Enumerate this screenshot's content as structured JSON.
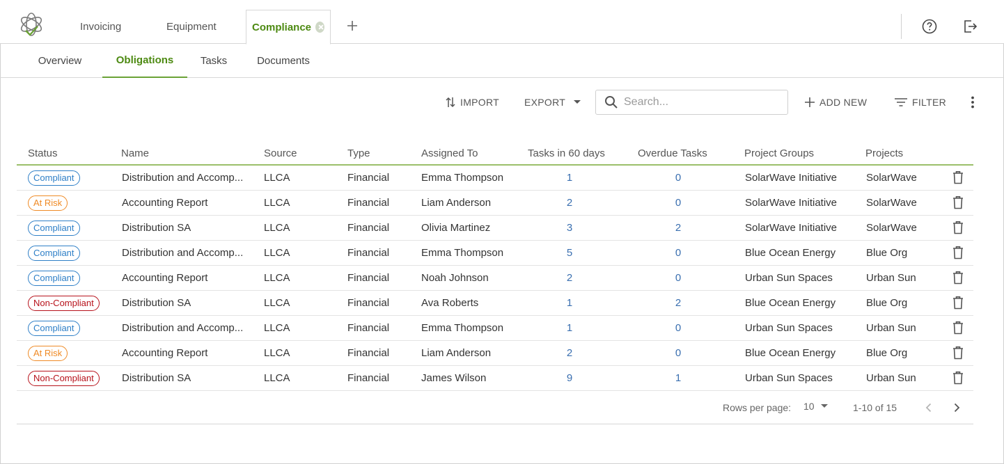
{
  "app_tabs": [
    {
      "label": "Invoicing"
    },
    {
      "label": "Equipment"
    },
    {
      "label": "Compliance"
    }
  ],
  "sub_tabs": [
    {
      "label": "Overview"
    },
    {
      "label": "Obligations"
    },
    {
      "label": "Tasks"
    },
    {
      "label": "Documents"
    }
  ],
  "active_sub_tab": "Obligations",
  "toolbar": {
    "import_label": "IMPORT",
    "export_label": "EXPORT",
    "search_placeholder": "Search...",
    "add_new_label": "ADD NEW",
    "filter_label": "FILTER"
  },
  "table": {
    "columns": [
      "Status",
      "Name",
      "Source",
      "Type",
      "Assigned To",
      "Tasks in 60 days",
      "Overdue Tasks",
      "Project Groups",
      "Projects"
    ],
    "rows": [
      {
        "status": "Compliant",
        "status_kind": "compliant",
        "name": "Distribution and Accomp...",
        "source": "LLCA",
        "type": "Financial",
        "assigned": "Emma Thompson",
        "tasks": "1",
        "overdue": "0",
        "group": "SolarWave Initiative",
        "project": "SolarWave"
      },
      {
        "status": "At Risk",
        "status_kind": "atrisk",
        "name": "Accounting Report",
        "source": "LLCA",
        "type": "Financial",
        "assigned": "Liam Anderson",
        "tasks": "2",
        "overdue": "0",
        "group": "SolarWave Initiative",
        "project": "SolarWave"
      },
      {
        "status": "Compliant",
        "status_kind": "compliant",
        "name": "Distribution SA",
        "source": "LLCA",
        "type": "Financial",
        "assigned": "Olivia Martinez",
        "tasks": "3",
        "overdue": "2",
        "group": "SolarWave Initiative",
        "project": "SolarWave"
      },
      {
        "status": "Compliant",
        "status_kind": "compliant",
        "name": "Distribution and Accomp...",
        "source": "LLCA",
        "type": "Financial",
        "assigned": "Emma Thompson",
        "tasks": "5",
        "overdue": "0",
        "group": "Blue Ocean Energy",
        "project": "Blue Org"
      },
      {
        "status": "Compliant",
        "status_kind": "compliant",
        "name": "Accounting Report",
        "source": "LLCA",
        "type": "Financial",
        "assigned": "Noah Johnson",
        "tasks": "2",
        "overdue": "0",
        "group": "Urban Sun Spaces",
        "project": "Urban Sun"
      },
      {
        "status": "Non-Compliant",
        "status_kind": "noncompliant",
        "name": "Distribution SA",
        "source": "LLCA",
        "type": "Financial",
        "assigned": "Ava Roberts",
        "tasks": "1",
        "overdue": "2",
        "group": "Blue Ocean Energy",
        "project": "Blue Org"
      },
      {
        "status": "Compliant",
        "status_kind": "compliant",
        "name": "Distribution and Accomp...",
        "source": "LLCA",
        "type": "Financial",
        "assigned": "Emma Thompson",
        "tasks": "1",
        "overdue": "0",
        "group": "Urban Sun Spaces",
        "project": "Urban Sun"
      },
      {
        "status": "At Risk",
        "status_kind": "atrisk",
        "name": "Accounting Report",
        "source": "LLCA",
        "type": "Financial",
        "assigned": "Liam Anderson",
        "tasks": "2",
        "overdue": "0",
        "group": "Blue Ocean Energy",
        "project": "Blue Org"
      },
      {
        "status": "Non-Compliant",
        "status_kind": "noncompliant",
        "name": "Distribution SA",
        "source": "LLCA",
        "type": "Financial",
        "assigned": "James Wilson",
        "tasks": "9",
        "overdue": "1",
        "group": "Urban Sun Spaces",
        "project": "Urban Sun"
      }
    ]
  },
  "pagination": {
    "rows_per_page_label": "Rows per page:",
    "rows_per_page": "10",
    "range": "1-10 of 15"
  },
  "colors": {
    "accent": "#4d8a12",
    "compliant": "#2e7fc7",
    "at_risk": "#ef8a25",
    "non_compliant": "#b7121b",
    "link": "#3a6fb0"
  },
  "icons": {
    "logo": "atom-logo-icon",
    "add_tab": "plus-icon",
    "help": "help-circle-icon",
    "logout": "logout-icon",
    "import": "swap-vertical-icon",
    "export": "caret-down-icon",
    "search": "search-icon",
    "add_new": "plus-icon",
    "filter": "filter-icon",
    "more": "kebab-icon",
    "delete": "trash-icon"
  }
}
